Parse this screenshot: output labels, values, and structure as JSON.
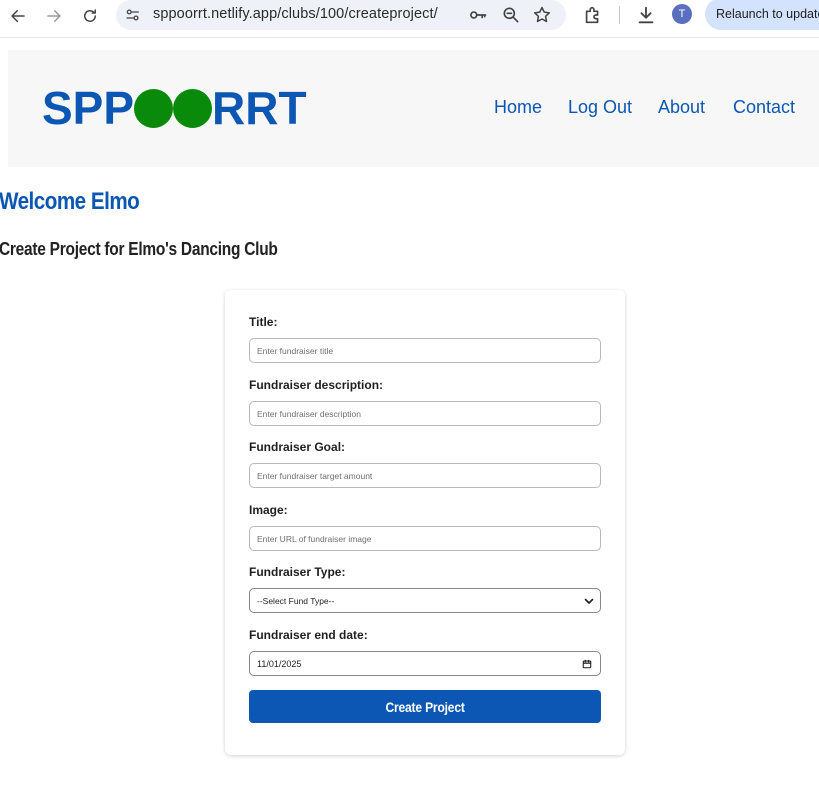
{
  "browser": {
    "url": "sppoorrt.netlify.app/clubs/100/createproject/",
    "profile_initial": "T",
    "relaunch_label": "Relaunch to update",
    "accent": "#d3e3fd"
  },
  "header": {
    "logo_left": "SPP",
    "logo_right": "RRT",
    "logo_color": "#0b57b3",
    "ball_color": "#0a8a0a",
    "nav": {
      "home": "Home",
      "logout": "Log Out",
      "about": "About",
      "contact": "Contact"
    }
  },
  "page": {
    "welcome": "Welcome Elmo",
    "subtitle": "Create Project for Elmo's Dancing Club"
  },
  "form": {
    "title_label": "Title:",
    "title_placeholder": "Enter fundraiser title",
    "description_label": "Fundraiser description:",
    "description_placeholder": "Enter fundraiser description",
    "goal_label": "Fundraiser Goal:",
    "goal_placeholder": "Enter fundraiser target amount",
    "image_label": "Image:",
    "image_placeholder": "Enter URL of fundraiser image",
    "type_label": "Fundraiser Type:",
    "type_selected": "--Select Fund Type--",
    "end_date_label": "Fundraiser end date:",
    "end_date_value": "11/01/2025",
    "submit_label": "Create Project"
  }
}
